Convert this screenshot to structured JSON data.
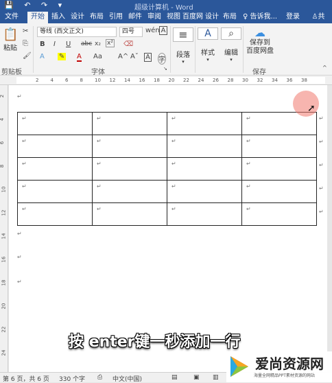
{
  "window": {
    "title": "超级计算机 - Word"
  },
  "tabs": [
    "文件",
    "开始",
    "插入",
    "设计",
    "布局",
    "引用",
    "邮件",
    "审阅",
    "视图",
    "百度网",
    "设计",
    "布局"
  ],
  "active_tab": "开始",
  "tell_me": "告诉我...",
  "login": "登录",
  "share": "共",
  "ribbon": {
    "paste": "粘贴",
    "clipboard_label": "剪贴板",
    "font_name": "等线 (西文正文)",
    "font_size": "四号",
    "font_label": "字体",
    "paragraph": "段落",
    "styles": "样式",
    "edit": "编辑",
    "save_baidu": "保存到\n百度网盘",
    "save_label": "保存",
    "bold": "B",
    "italic": "I",
    "underline": "U",
    "strike": "abc",
    "sub": "x₂",
    "sup": "x²",
    "font_color": "A",
    "aa": "Aa",
    "grow": "A^",
    "shrink": "Aˇ",
    "clear": "A",
    "wen": "wén"
  },
  "ruler_numbers": [
    "2",
    "4",
    "6",
    "8",
    "10",
    "12",
    "14",
    "16",
    "18",
    "20",
    "22",
    "24",
    "26",
    "28",
    "30",
    "32",
    "34",
    "36",
    "38"
  ],
  "vruler_numbers": [
    "2",
    "4",
    "6",
    "8",
    "10",
    "12",
    "14",
    "16",
    "18",
    "20",
    "22",
    "24"
  ],
  "paragraph_mark": "↵",
  "table": {
    "rows": 5,
    "cols": 4
  },
  "caption": "按 enter键一秒添加一行",
  "status": {
    "page": "第 6 页，共 6 页",
    "words": "330 个字",
    "lang": "中文(中国)"
  },
  "watermark": {
    "brand": "爱尚资源网",
    "tagline": "海量全网精品PPT素材资源的网站"
  }
}
